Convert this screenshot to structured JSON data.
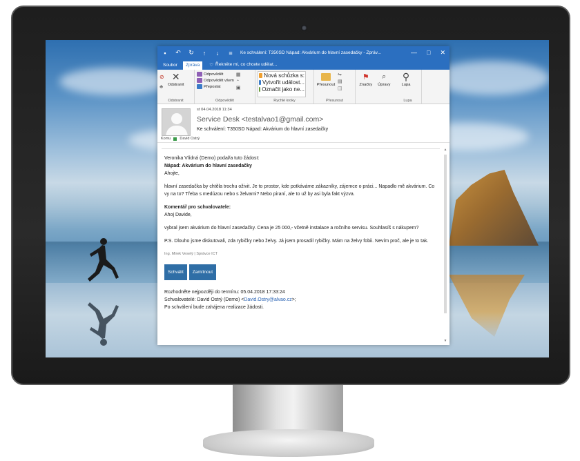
{
  "window": {
    "title": "Ke schválení: T350SD Nápad: Akvárium do hlavní zasedačky - Zpráv...",
    "controls": [
      "—",
      "□",
      "✕"
    ]
  },
  "tabs": [
    "Soubor",
    "Zpráva"
  ],
  "tell_me": "Řekněte mi, co chcete udělat...",
  "ribbon": {
    "delete_group": {
      "label": "Odstranit",
      "delete_label": "Odstranit"
    },
    "respond_group": {
      "label": "Odpovědět",
      "items": [
        "Odpovědět",
        "Odpovědět všem",
        "Přeposlat"
      ]
    },
    "quicksteps_group": {
      "label": "Rychlé kroky",
      "items": [
        "Nová schůzka s:",
        "Vytvořit událost...",
        "Označit jako ne..."
      ]
    },
    "move_group": {
      "label": "Přesunout",
      "move_label": "Přesunout"
    },
    "tags_label": "Značky",
    "edit_label": "Úpravy",
    "zoom_group": {
      "label": "Lupa",
      "zoom_label": "Lupa"
    }
  },
  "message": {
    "date": "st 04.04.2018 11:34",
    "from": "Service Desk <testalvao1@gmail.com>",
    "subject": "Ke schválení: T350SD Nápad: Akvárium do hlavní zasedačky",
    "to_label": "Komu",
    "to_name": "David Ostrý",
    "body": {
      "line1": "Veronika Vlídná (Demo) podal/a tuto žádost:",
      "line2": "Nápad: Akvárium do hlavní zasedačky",
      "line3": "Ahojte,",
      "para1": "hlavní zasedačka by chtěla trochu oživit. Je to prostor, kde potkáváme zákazníky, zájemce o práci... Napadlo mě akvárium. Co vy na to? Třeba s medúzou nebo s želvami? Nebo piraní, ale to už by asi byla fakt výzva.",
      "comment_heading": "Komentář pro schvalovatele:",
      "comment_greeting": "Ahoj Davide,",
      "comment_para": "vybral jsem akvárium do hlavní zasedačky. Cena je 25 000,- včetně instalace a ročního servisu. Souhlasíš s nákupem?",
      "ps": "P.S. Dlouho jsme diskutovali, zda rybičky nebo želvy. Já jsem prosadil rybičky. Mám na želvy fobii. Nevím proč, ale je to tak.",
      "signature": "Ing. Mirek Veselý | Správce ICT",
      "approve_button": "Schválit",
      "reject_button": "Zamítnout",
      "deadline": "Rozhodněte nejpozději do termínu: 05.04.2018 17:33:24",
      "approvers_prefix": "Schvalovatelé: David Ostrý (Demo)   <",
      "approver_email": "David.Ostry@alvao.cz",
      "approvers_suffix": ">;",
      "after_approval": "Po schválení bude zahájena realizace žádosti."
    }
  }
}
